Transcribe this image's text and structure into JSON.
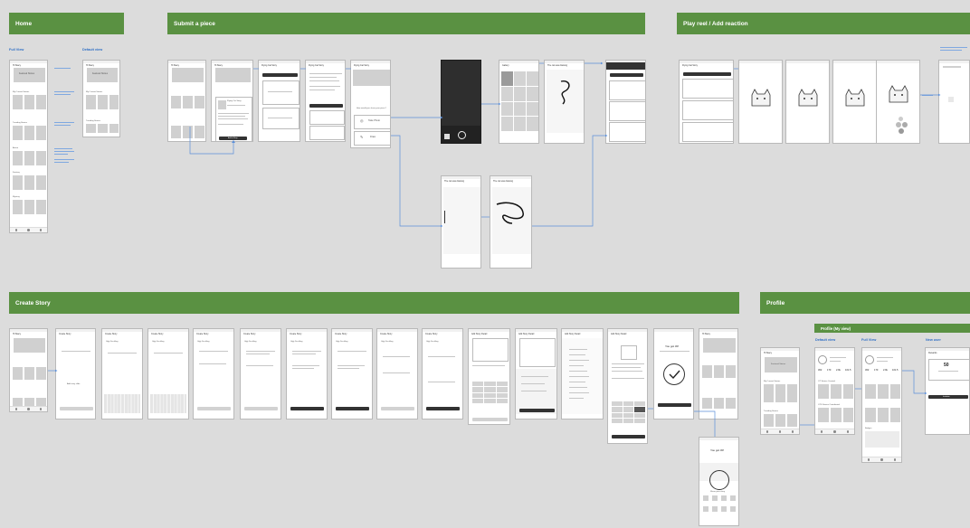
{
  "sections": {
    "home": "Home",
    "submit": "Submit a piece",
    "play": "Play reel / Add reaction",
    "create": "Create Story",
    "profile": "Profile",
    "profile_my_view": "Profile (My view)"
  },
  "labels": {
    "home_full": "Full View",
    "home_default": "Default view",
    "profile_default": "Default view",
    "profile_full": "Full View",
    "profile_new": "New user"
  },
  "phones": {
    "home_full": {
      "title": "Hi Stacy",
      "featured": "Featured Stories",
      "current": "My Current Stories",
      "trending": "Trending Stories",
      "action": "Action",
      "fantasy": "Fantasy",
      "mystery": "Mystery"
    },
    "home_default": {
      "title": "Hi Stacy",
      "featured": "Featured Stories",
      "current": "My Current Stories",
      "trending": "Trending Stories"
    },
    "submit_story": {
      "title": "Flying Cat Story",
      "button": "Add to Story"
    },
    "photo_sheet": {
      "take_photo": "Take Photo",
      "draw": "Draw"
    },
    "create_first": {
      "title": "Create Story",
      "add": "Add story slide",
      "button": "Next"
    },
    "create_ugly": {
      "title": "Create Story",
      "name": "Ugly Duckling"
    },
    "story_detail": {
      "title": "Add Story Detail",
      "button": "Next"
    },
    "success": {
      "title": "You got 30!",
      "share": "Share your story"
    },
    "profile_main": {
      "title": "Hi Stacy",
      "featured": "Featured Stories",
      "current": "My Current Stories",
      "trending": "Trending Stories"
    },
    "profile_stats": {
      "posts": "302",
      "followers": "170",
      "following": "2.9k",
      "score": "101.5",
      "created": "OT Stories Created",
      "contributed": "OTS Stories Contributed",
      "badges": "Badges"
    },
    "new_user": {
      "points": "50",
      "button": "Invitation"
    }
  }
}
